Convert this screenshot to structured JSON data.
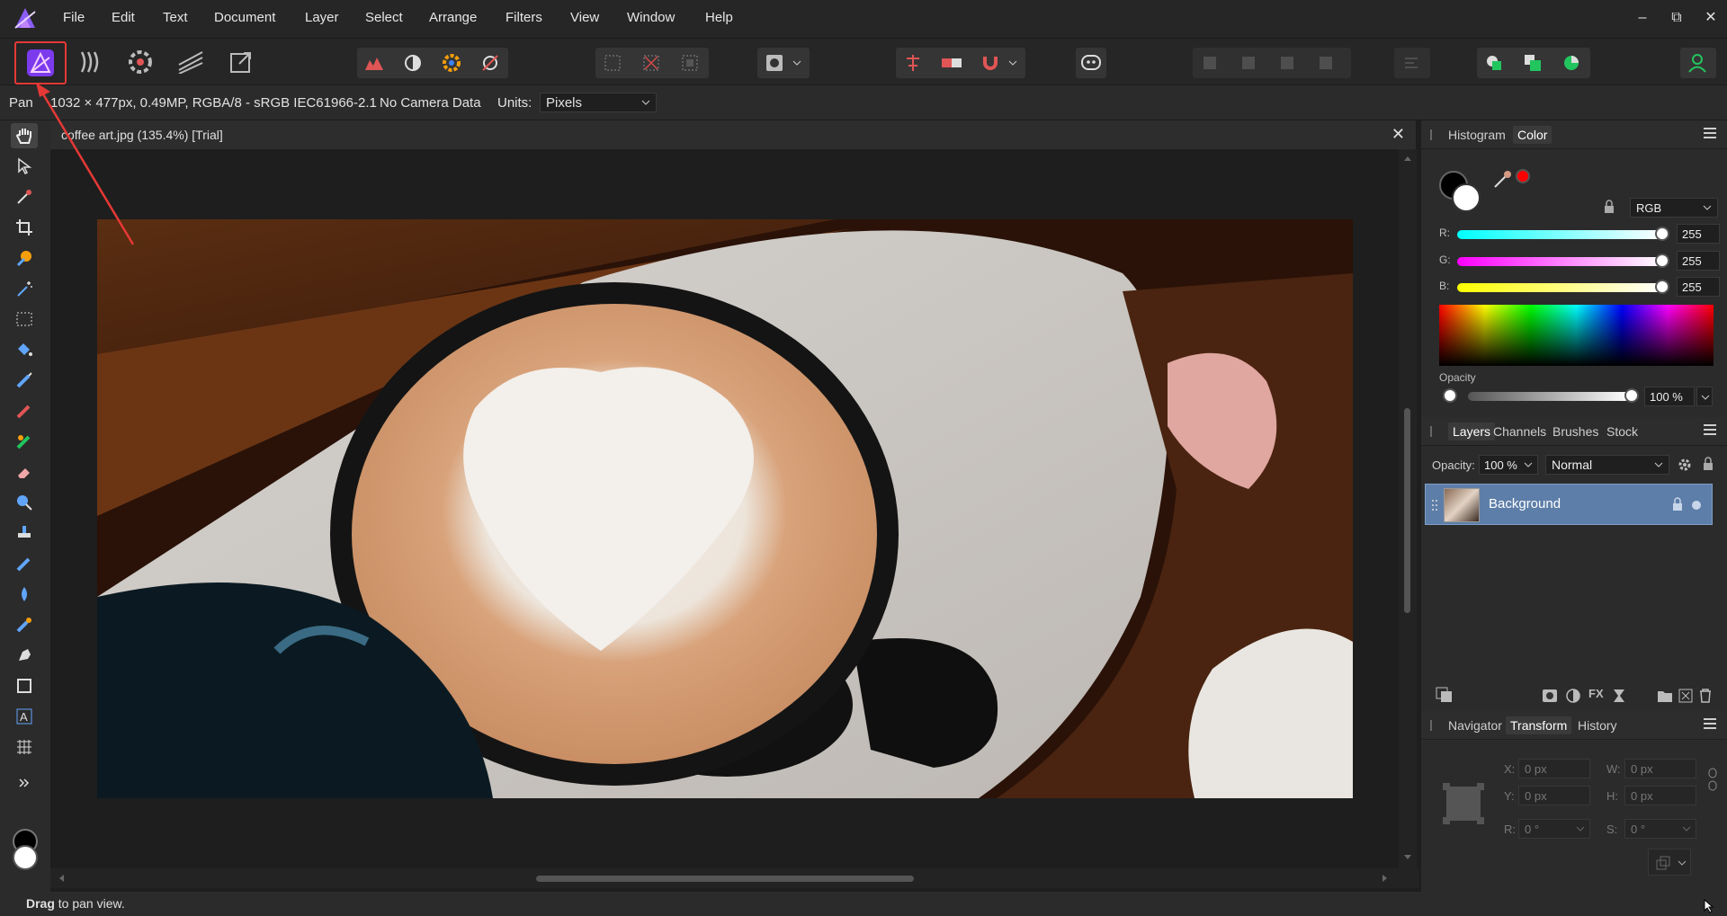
{
  "menu": [
    "File",
    "Edit",
    "Text",
    "Document",
    "Layer",
    "Select",
    "Arrange",
    "Filters",
    "View",
    "Window",
    "Help"
  ],
  "window_controls": {
    "minimize": "–",
    "restore": "⧉",
    "close": "✕"
  },
  "context": {
    "tool": "Pan",
    "doc_info": "1032 × 477px, 0.49MP, RGBA/8 - sRGB IEC61966-2.1",
    "camera": "No Camera Data",
    "units_label": "Units:",
    "units_value": "Pixels"
  },
  "document": {
    "tab_title": "coffee art.jpg (135.4%) [Trial]",
    "close": "✕"
  },
  "status": {
    "bold": "Drag",
    "rest": " to pan view."
  },
  "color_panel": {
    "tabs": [
      "Histogram",
      "Color"
    ],
    "active_tab": "Color",
    "model": "RGB",
    "r_label": "R:",
    "r_value": "255",
    "g_label": "G:",
    "g_value": "255",
    "b_label": "B:",
    "b_value": "255",
    "opacity_label": "Opacity",
    "opacity_value": "100 %",
    "accent_color": "#ff0000"
  },
  "layers_panel": {
    "tabs": [
      "Layers",
      "Channels",
      "Brushes",
      "Stock"
    ],
    "active_tab": "Layers",
    "opacity_label": "Opacity:",
    "opacity_value": "100 %",
    "blend_mode": "Normal",
    "layers": [
      {
        "name": "Background"
      }
    ]
  },
  "transform_panel": {
    "tabs": [
      "Navigator",
      "Transform",
      "History"
    ],
    "active_tab": "Transform",
    "x_label": "X:",
    "x_value": "0 px",
    "y_label": "Y:",
    "y_value": "0 px",
    "w_label": "W:",
    "w_value": "0 px",
    "h_label": "H:",
    "h_value": "0 px",
    "r_label": "R:",
    "r_value": "0 °",
    "s_label": "S:",
    "s_value": "0 °"
  }
}
